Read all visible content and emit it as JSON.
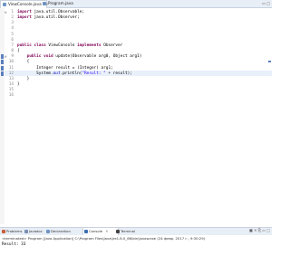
{
  "editor_tabs": [
    {
      "label": "ViewConsole.java",
      "active": true
    },
    {
      "label": "Program.java",
      "active": false
    }
  ],
  "code": {
    "line_numbers": [
      "1",
      "2",
      "3",
      "4",
      "5",
      "6",
      "7",
      "8",
      "9",
      "10",
      "11",
      "12",
      "13",
      "14",
      "15",
      "16"
    ],
    "lines": [
      [
        {
          "t": "import",
          "c": "kw"
        },
        {
          "t": " java.util.Observable;",
          "c": "id"
        }
      ],
      [
        {
          "t": "import",
          "c": "kw"
        },
        {
          "t": " java.util.Observer;",
          "c": "id"
        }
      ],
      [],
      [],
      [],
      [],
      [
        {
          "t": "public class",
          "c": "kw"
        },
        {
          "t": " ViewConsole ",
          "c": "id"
        },
        {
          "t": "implements",
          "c": "kw"
        },
        {
          "t": " Observer",
          "c": "id"
        }
      ],
      [
        {
          "t": "{",
          "c": "id"
        }
      ],
      [
        {
          "t": "    ",
          "c": "id"
        },
        {
          "t": "public void",
          "c": "kw"
        },
        {
          "t": " update(Observable arg0, Object arg1)",
          "c": "id"
        }
      ],
      [
        {
          "t": "    {",
          "c": "id"
        }
      ],
      [
        {
          "t": "        Integer result = (Integer) arg1;",
          "c": "id"
        }
      ],
      [
        {
          "t": "        System.",
          "c": "id"
        },
        {
          "t": "out",
          "c": "fld"
        },
        {
          "t": ".println(",
          "c": "id"
        },
        {
          "t": "\"Result: \"",
          "c": "str"
        },
        {
          "t": " + result);",
          "c": "id"
        }
      ],
      [
        {
          "t": "    }",
          "c": "id"
        }
      ],
      [
        {
          "t": "}",
          "c": "id"
        }
      ],
      [],
      []
    ]
  },
  "panel_tabs": [
    {
      "label": "Problems",
      "color": "#c95f3c",
      "active": false
    },
    {
      "label": "Javadoc",
      "color": "#7a8fb5",
      "active": false
    },
    {
      "label": "Declaration",
      "color": "#6e93c4",
      "active": false
    },
    {
      "label": "Console",
      "color": "#3b6fb5",
      "active": true,
      "close": "✕"
    },
    {
      "label": "Terminal",
      "color": "#444444",
      "active": false
    }
  ],
  "console": {
    "terminated": "<terminated> Program [Java Application] C:\\Program Files\\Java\\jre1.8.0_66\\bin\\javaw.exe (24 февр. 2017 г., 9:30:29)",
    "output": "Result: 33"
  },
  "window_controls": "▭ ▢",
  "panel_controls": "■ ✕ ⎘ ▭ ▢"
}
